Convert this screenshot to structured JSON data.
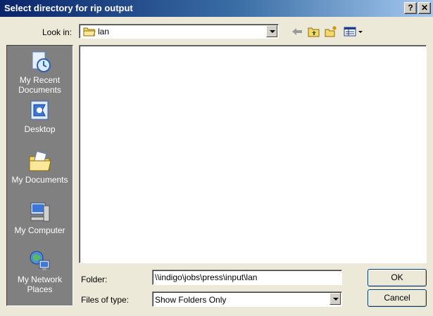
{
  "window": {
    "title": "Select directory for rip output",
    "help_label": "?",
    "close_label": "✕"
  },
  "lookin": {
    "label": "Look in:",
    "value": "lan"
  },
  "places": [
    {
      "label_line1": "My Recent",
      "label_line2": "Documents",
      "icon": "recent-documents-icon"
    },
    {
      "label_line1": "Desktop",
      "label_line2": "",
      "icon": "desktop-icon"
    },
    {
      "label_line1": "My Documents",
      "label_line2": "",
      "icon": "my-documents-icon"
    },
    {
      "label_line1": "My Computer",
      "label_line2": "",
      "icon": "my-computer-icon"
    },
    {
      "label_line1": "My Network",
      "label_line2": "Places",
      "icon": "network-places-icon"
    }
  ],
  "form": {
    "folder_label": "Folder:",
    "folder_value": "\\\\indigo\\jobs\\press\\input\\lan",
    "type_label": "Files of type:",
    "type_value": "Show Folders Only"
  },
  "buttons": {
    "ok": "OK",
    "cancel": "Cancel"
  }
}
